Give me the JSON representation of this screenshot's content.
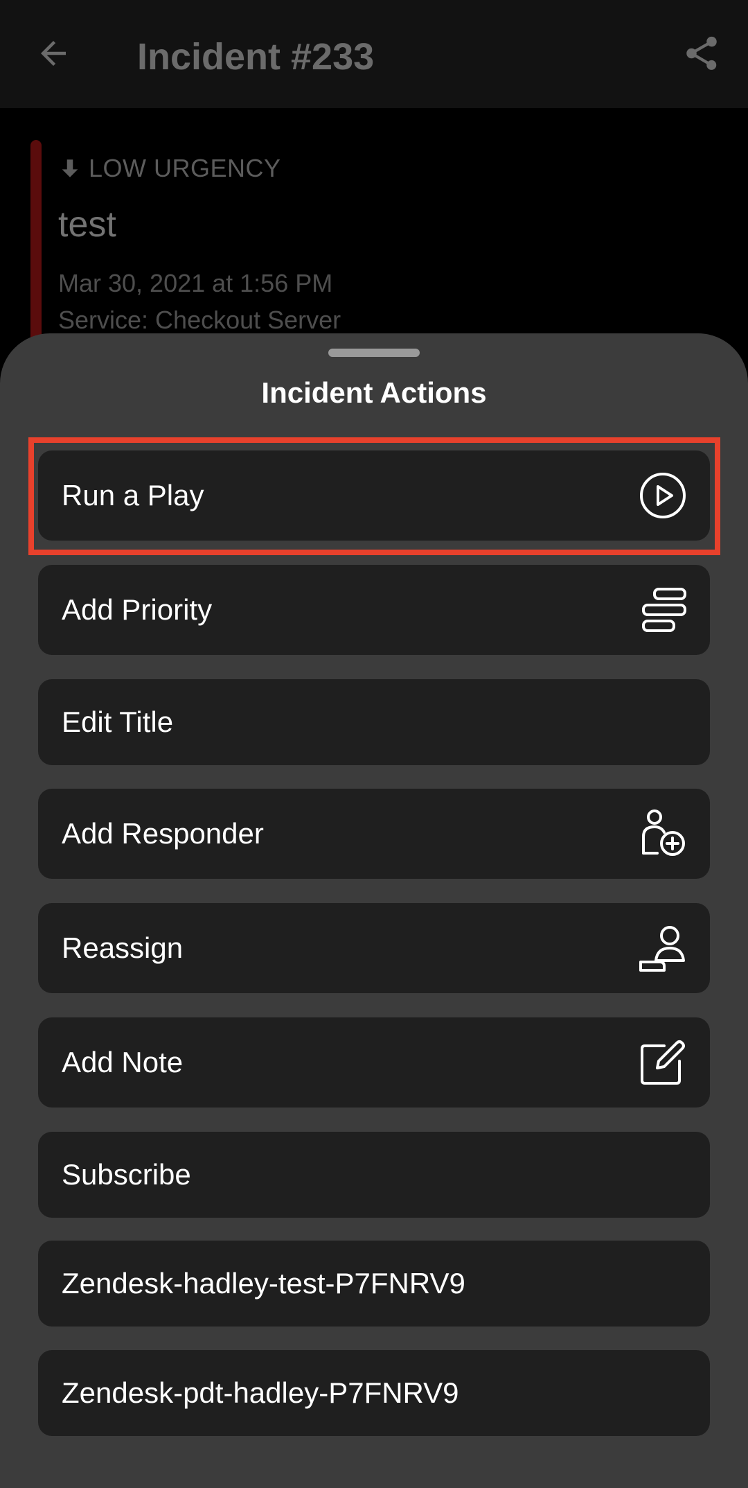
{
  "appbar": {
    "title": "Incident #233",
    "back_icon": "arrow-left-icon",
    "share_icon": "share-icon"
  },
  "incident": {
    "urgency": "LOW URGENCY",
    "title": "test",
    "date": "Mar 30, 2021 at 1:56 PM",
    "service": "Service: Checkout Server"
  },
  "sheet": {
    "title": "Incident Actions",
    "actions": [
      {
        "label": "Run a Play",
        "icon": "play-circle-icon"
      },
      {
        "label": "Add Priority",
        "icon": "priority-bars-icon"
      },
      {
        "label": "Edit Title",
        "icon": ""
      },
      {
        "label": "Add Responder",
        "icon": "add-person-icon"
      },
      {
        "label": "Reassign",
        "icon": "reassign-person-icon"
      },
      {
        "label": "Add Note",
        "icon": "edit-note-icon"
      },
      {
        "label": "Subscribe",
        "icon": ""
      },
      {
        "label": "Zendesk-hadley-test-P7FNRV9",
        "icon": ""
      },
      {
        "label": "Zendesk-pdt-hadley-P7FNRV9",
        "icon": ""
      }
    ]
  },
  "colors": {
    "highlight": "#e8412c",
    "sheet_background": "#3c3c3c",
    "button_background": "#1f1f1f"
  }
}
